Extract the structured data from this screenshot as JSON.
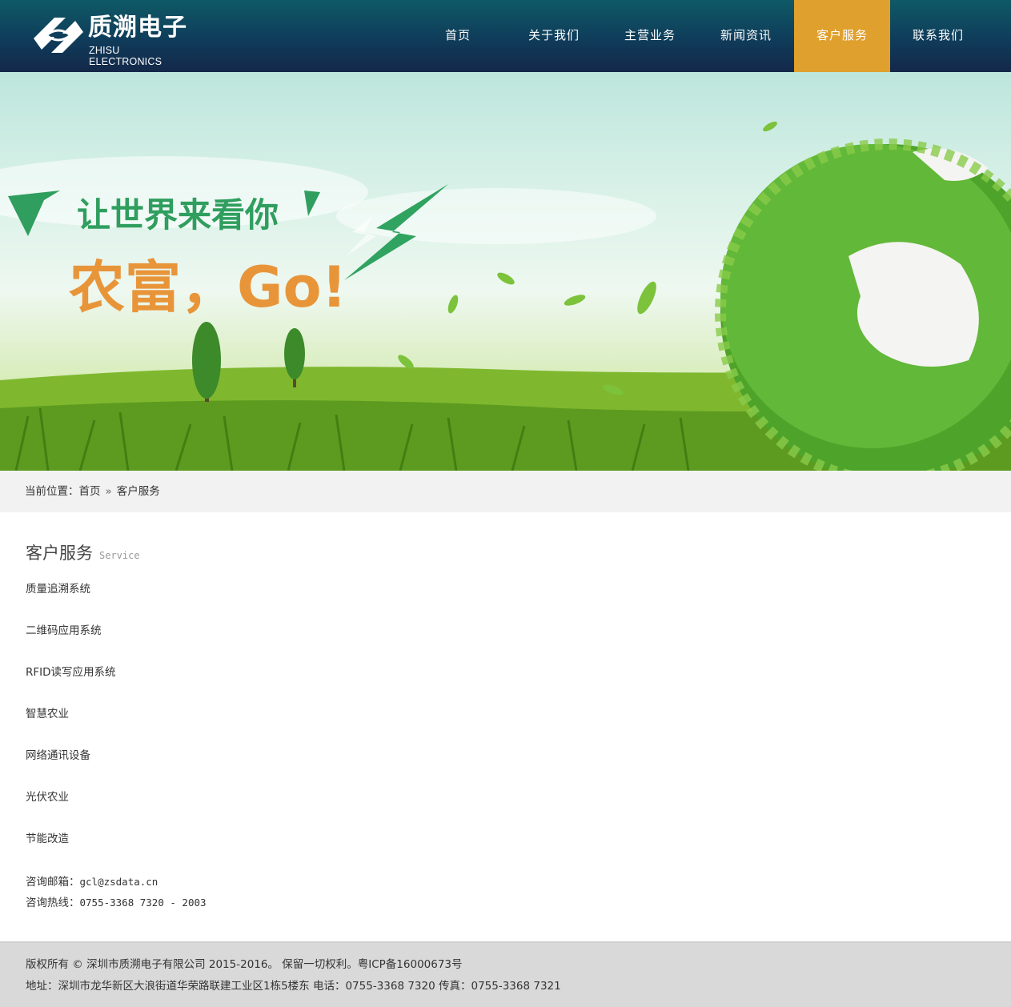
{
  "header": {
    "logo_cn": "质溯电子",
    "logo_en": "ZHISU ELECTRONICS",
    "nav": [
      {
        "label": "首页",
        "active": false
      },
      {
        "label": "关于我们",
        "active": false
      },
      {
        "label": "主营业务",
        "active": false
      },
      {
        "label": "新闻资讯",
        "active": false
      },
      {
        "label": "客户服务",
        "active": true
      },
      {
        "label": "联系我们",
        "active": false
      }
    ]
  },
  "banner": {
    "slogan": "让世界来看你",
    "headline": "农富，Go!"
  },
  "breadcrumb": {
    "prefix": "当前位置：",
    "home": "首页",
    "separator": "»",
    "current": "客户服务"
  },
  "main": {
    "title": "客户服务",
    "title_en": "Service",
    "services": [
      "质量追溯系统",
      "二维码应用系统",
      "RFID读写应用系统",
      "智慧农业",
      "网络通讯设备",
      "光伏农业",
      "节能改造"
    ],
    "email_label": "咨询邮箱：",
    "email": "gcl@zsdata.cn",
    "hotline_label": "咨询热线：",
    "hotline": "0755-3368 7320 - 2003"
  },
  "footer": {
    "copyright": "版权所有 © 深圳市质溯电子有限公司 2015-2016。 保留一切权利。粤ICP备16000673号",
    "address": "地址：深圳市龙华新区大浪街道华荣路联建工业区1栋5楼东 电话：0755-3368 7320 传真：0755-3368 7321"
  },
  "colors": {
    "header_top": "#0f5a66",
    "header_bottom": "#14284a",
    "nav_active": "#e0a02e",
    "breadcrumb_bg": "#f2f2f2",
    "footer_bg": "#d9d9d9"
  }
}
